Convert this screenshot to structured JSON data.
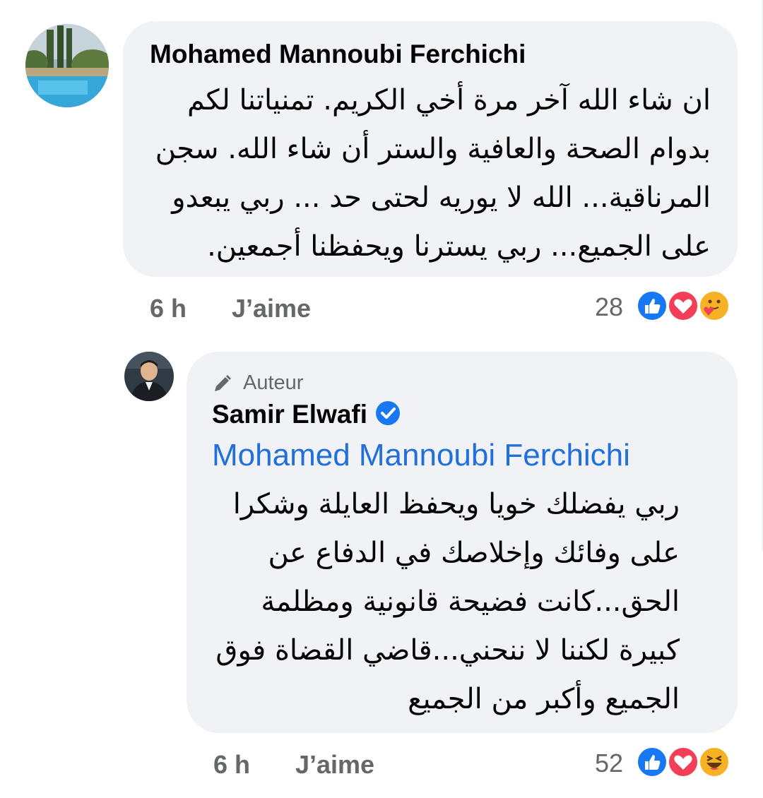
{
  "comment": {
    "author": "Mohamed Mannoubi Ferchichi",
    "lines": [
      "ان شاء الله آخر مرة أخي الكريم. تمنياتنا لكم",
      "بدوام الصحة والعافية والستر أن شاء الله. سجن",
      "المرناقية... الله لا يوريه لحتى حد ... ربي يبعدو",
      "على الجميع... ربي يسترنا ويحفظنا أجمعين."
    ],
    "time": "6 h",
    "like_label": "J’aime",
    "reaction_count": "28",
    "reactions": [
      "like-icon",
      "love-icon",
      "care-icon"
    ]
  },
  "reply": {
    "badge": "Auteur",
    "author": "Samir Elwafi",
    "mention": "Mohamed Mannoubi Ferchichi",
    "lines": [
      "ربي يفضلك خويا ويحفظ العايلة وشكرا",
      "على وفائك وإخلاصك في الدفاع عن",
      "الحق...كانت فضيحة قانونية ومظلمة",
      "كبيرة لكننا لا ننحني...قاضي القضاة فوق",
      "الجميع وأكبر من الجميع"
    ],
    "time": "6 h",
    "like_label": "J’aime",
    "reaction_count": "52",
    "reactions": [
      "like-icon",
      "love-icon",
      "haha-icon"
    ]
  },
  "colors": {
    "bubble": "#f0f2f5",
    "meta": "#65676b",
    "link": "#216fdb",
    "like": "#1877f2",
    "love": "#f33e58"
  }
}
